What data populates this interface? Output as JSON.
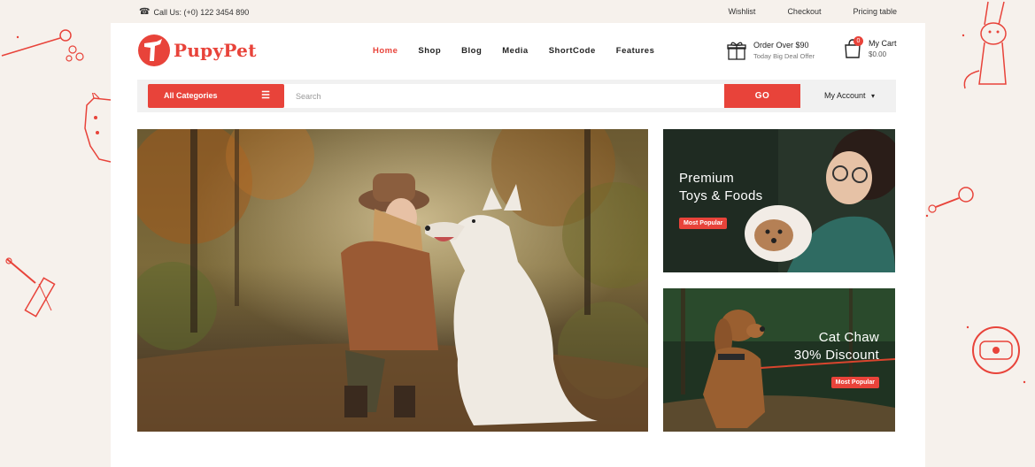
{
  "topbar": {
    "call": "Call Us: (+0) 122 3454 890",
    "links": [
      "Wishlist",
      "Checkout",
      "Pricing table"
    ]
  },
  "logo": {
    "text": "PupyPet"
  },
  "nav": {
    "items": [
      "Home",
      "Shop",
      "Blog",
      "Media",
      "ShortCode",
      "Features"
    ],
    "active": "Home"
  },
  "order": {
    "title": "Order Over $90",
    "subtitle": "Today Big Deal Offer"
  },
  "cart": {
    "label": "My Cart",
    "amount": "$0.00",
    "count": "0"
  },
  "search": {
    "categories_label": "All Categories",
    "placeholder": "Search",
    "go_label": "GO",
    "account_label": "My Account"
  },
  "banners": [
    {
      "line1": "Premium",
      "line2": "Toys & Foods",
      "badge": "Most Popular"
    },
    {
      "line1": "Cat Chaw",
      "line2": "30% Discount",
      "badge": "Most Popular"
    }
  ],
  "colors": {
    "accent": "#e8433a",
    "background": "#f6f1ec"
  }
}
